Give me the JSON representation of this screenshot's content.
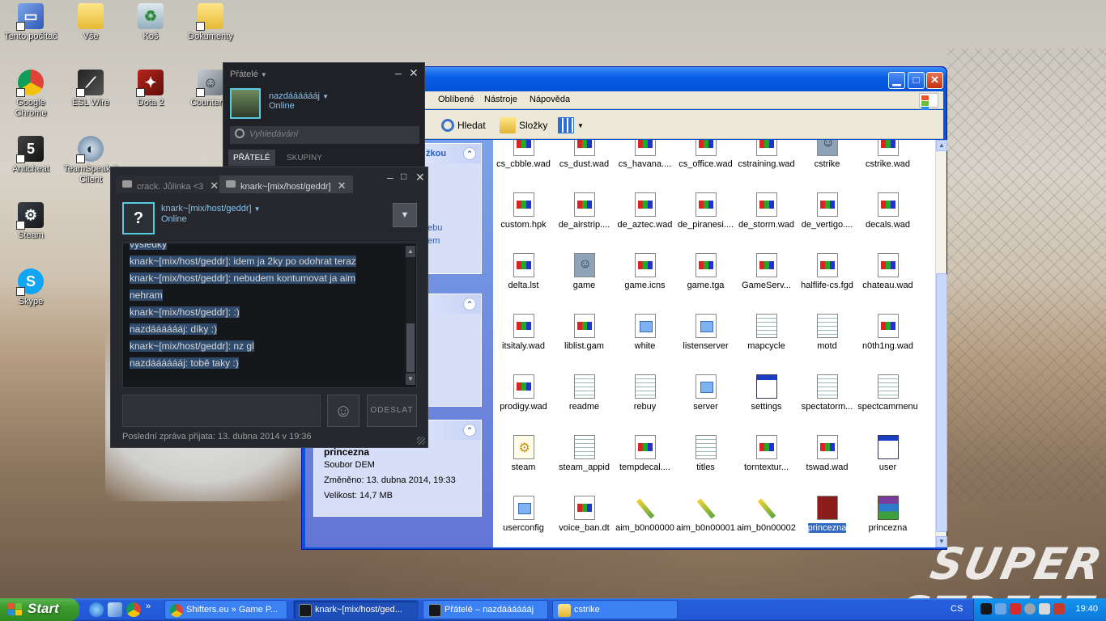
{
  "desktop": {
    "icons": [
      {
        "label": "Tento počítač",
        "icon": "computer-icon"
      },
      {
        "label": "Vše",
        "icon": "folder-icon"
      },
      {
        "label": "Koš",
        "icon": "recycle-bin-icon"
      },
      {
        "label": "Dokumenty",
        "icon": "documents-folder-icon"
      },
      {
        "label": "Google Chrome",
        "icon": "chrome-icon"
      },
      {
        "label": "ESL Wire",
        "icon": "esl-wire-icon"
      },
      {
        "label": "Dota 2",
        "icon": "dota2-icon"
      },
      {
        "label": "Counter S",
        "icon": "counter-strike-icon"
      },
      {
        "label": "Anticheat",
        "icon": "anticheat-icon"
      },
      {
        "label": "TeamSpeak 3 Client",
        "icon": "teamspeak-icon"
      },
      {
        "label": "Steam",
        "icon": "steam-icon"
      },
      {
        "label": "Skype",
        "icon": "skype-icon"
      }
    ],
    "wallpaper_text": "SUPER STREET"
  },
  "explorer": {
    "menu": [
      "Oblíbené",
      "Nástroje",
      "Nápověda"
    ],
    "toolbar": {
      "search_label": "Hledat",
      "folders_label": "Složky"
    },
    "left_panel": {
      "panel1_title_fragment": "žkou",
      "panel1_links": [
        "ebu",
        "em"
      ]
    },
    "details": {
      "name": "princezna",
      "type": "Soubor DEM",
      "modified": "Změněno: 13. dubna 2014, 19:33",
      "size": "Velikost: 14,7 MB"
    },
    "files": [
      {
        "name": "cs_cbble.wad",
        "kind": "wad"
      },
      {
        "name": "cs_dust.wad",
        "kind": "wad"
      },
      {
        "name": "cs_havana....",
        "kind": "wad"
      },
      {
        "name": "cs_office.wad",
        "kind": "wad"
      },
      {
        "name": "cstraining.wad",
        "kind": "wad"
      },
      {
        "name": "cstrike",
        "kind": "cs"
      },
      {
        "name": "cstrike.wad",
        "kind": "wad"
      },
      {
        "name": "custom.hpk",
        "kind": "wad"
      },
      {
        "name": "de_airstrip....",
        "kind": "wad"
      },
      {
        "name": "de_aztec.wad",
        "kind": "wad"
      },
      {
        "name": "de_piranesi....",
        "kind": "wad"
      },
      {
        "name": "de_storm.wad",
        "kind": "wad"
      },
      {
        "name": "de_vertigo....",
        "kind": "wad"
      },
      {
        "name": "decals.wad",
        "kind": "wad"
      },
      {
        "name": "delta.lst",
        "kind": "wad"
      },
      {
        "name": "game",
        "kind": "cs"
      },
      {
        "name": "game.icns",
        "kind": "wad"
      },
      {
        "name": "game.tga",
        "kind": "wad"
      },
      {
        "name": "GameServ...",
        "kind": "wad"
      },
      {
        "name": "halflife-cs.fgd",
        "kind": "wad"
      },
      {
        "name": "chateau.wad",
        "kind": "wad"
      },
      {
        "name": "itsitaly.wad",
        "kind": "wad"
      },
      {
        "name": "liblist.gam",
        "kind": "wad"
      },
      {
        "name": "white",
        "kind": "gen"
      },
      {
        "name": "listenserver",
        "kind": "gen"
      },
      {
        "name": "mapcycle",
        "kind": "txt"
      },
      {
        "name": "motd",
        "kind": "txt"
      },
      {
        "name": "n0th1ng.wad",
        "kind": "wad"
      },
      {
        "name": "prodigy.wad",
        "kind": "wad"
      },
      {
        "name": "readme",
        "kind": "txt"
      },
      {
        "name": "rebuy",
        "kind": "txt"
      },
      {
        "name": "server",
        "kind": "gen"
      },
      {
        "name": "settings",
        "kind": "exe"
      },
      {
        "name": "spectatorm...",
        "kind": "txt"
      },
      {
        "name": "spectcammenu",
        "kind": "txt"
      },
      {
        "name": "steam",
        "kind": "gear"
      },
      {
        "name": "steam_appid",
        "kind": "txt"
      },
      {
        "name": "tempdecal....",
        "kind": "wad"
      },
      {
        "name": "titles",
        "kind": "txt"
      },
      {
        "name": "torntextur...",
        "kind": "wad"
      },
      {
        "name": "tswad.wad",
        "kind": "wad"
      },
      {
        "name": "user",
        "kind": "exe"
      },
      {
        "name": "userconfig",
        "kind": "gen"
      },
      {
        "name": "voice_ban.dt",
        "kind": "wad"
      },
      {
        "name": "aim_b0n00000",
        "kind": "pen"
      },
      {
        "name": "aim_b0n00001",
        "kind": "pen"
      },
      {
        "name": "aim_b0n00002",
        "kind": "pen"
      },
      {
        "name": "princezna",
        "kind": "dem",
        "selected": true
      },
      {
        "name": "princezna",
        "kind": "rar"
      }
    ]
  },
  "friends": {
    "title": "Přátelé",
    "user_name": "nazdááááááj",
    "user_status": "Online",
    "search_placeholder": "Vyhledávání",
    "tabs": [
      "PŘÁTELÉ",
      "SKUPINY"
    ]
  },
  "chat": {
    "tabs": [
      {
        "label": "crack. Jůlinka <3",
        "active": false
      },
      {
        "label": "knark~[mix/host/geddr]",
        "active": true
      }
    ],
    "contact_name": "knark~[mix/host/geddr]",
    "contact_status": "Online",
    "avatar_glyph": "?",
    "messages": [
      "výsledky",
      "knark~[mix/host/geddr]: idem ja 2ky po odohrat teraz",
      "knark~[mix/host/geddr]: nebudem kontumovat ja aim",
      "nehram",
      "knark~[mix/host/geddr]: :)",
      "nazdááááááj: díky :)",
      "knark~[mix/host/geddr]: nz gl",
      "nazdááááááj: tobě taky :)"
    ],
    "send_label": "ODESLAT",
    "footer": "Poslední zpráva přijata: 13. dubna 2014 v 19:36"
  },
  "taskbar": {
    "start_label": "Start",
    "tasks": [
      {
        "label": "Shifters.eu » Game P...",
        "icon": "chrome-icon",
        "active": false
      },
      {
        "label": "knark~[mix/host/ged...",
        "icon": "steam-icon",
        "active": true
      },
      {
        "label": "Přátelé – nazdááááááj",
        "icon": "steam-icon",
        "active": false
      },
      {
        "label": "cstrike",
        "icon": "folder-icon",
        "active": false
      }
    ],
    "language": "CS",
    "clock": "19:40"
  }
}
